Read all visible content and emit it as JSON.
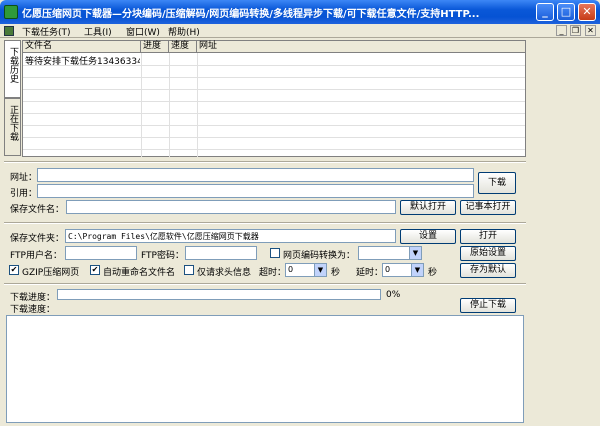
{
  "window": {
    "title": "亿愿压缩网页下载器—分块编码/压缩解码/网页编码转换/多线程异步下载/可下载任意文件/支持HTTP...",
    "minimize": "_",
    "maximize": "□",
    "close": "✕"
  },
  "menu": {
    "items": [
      "下载任务(T)",
      "工具(I)",
      "窗口(W)",
      "帮助(H)"
    ],
    "mdi_min": "_",
    "mdi_restore": "❐",
    "mdi_close": "✕"
  },
  "side_tabs": {
    "history": "下载历史",
    "downloading": "正在下载"
  },
  "grid": {
    "headers": [
      "文件名",
      "进度",
      "速度",
      "网址"
    ],
    "rows": [
      {
        "name": "等待安排下载任务13436334",
        "progress": "",
        "speed": "",
        "url": ""
      }
    ]
  },
  "form": {
    "url_label": "网址：",
    "ref_label": "引用：",
    "save_name_label": "保存文件名：",
    "download_button": "下载",
    "default_open_button": "默认打开",
    "notepad_open_button": "记事本打开",
    "folder_label": "保存文件夹：",
    "folder_value": "C:\\Program Files\\亿愿软件\\亿愿压缩网页下载器",
    "settings_button": "设置",
    "open_button": "打开",
    "ftp_user_label": "FTP用户名：",
    "ftp_pass_label": "FTP密码：",
    "encoding_label": "网页编码转换为：",
    "original_settings_button": "原始设置",
    "gzip_label": "GZIP压缩网页",
    "gzip_checked": true,
    "rename_label": "自动重命名文件名",
    "rename_checked": true,
    "header_only_label": "仅请求头信息",
    "header_only_checked": false,
    "timeout_label": "超时：",
    "timeout_value": "0",
    "timeout_unit": "秒",
    "delay_label": "延时：",
    "delay_value": "0",
    "delay_unit": "秒",
    "save_default_button": "存为默认",
    "progress_label": "下载进度：",
    "progress_value": 0,
    "progress_text": "0%",
    "speed_label": "下载速度：",
    "stop_button": "停止下载"
  }
}
